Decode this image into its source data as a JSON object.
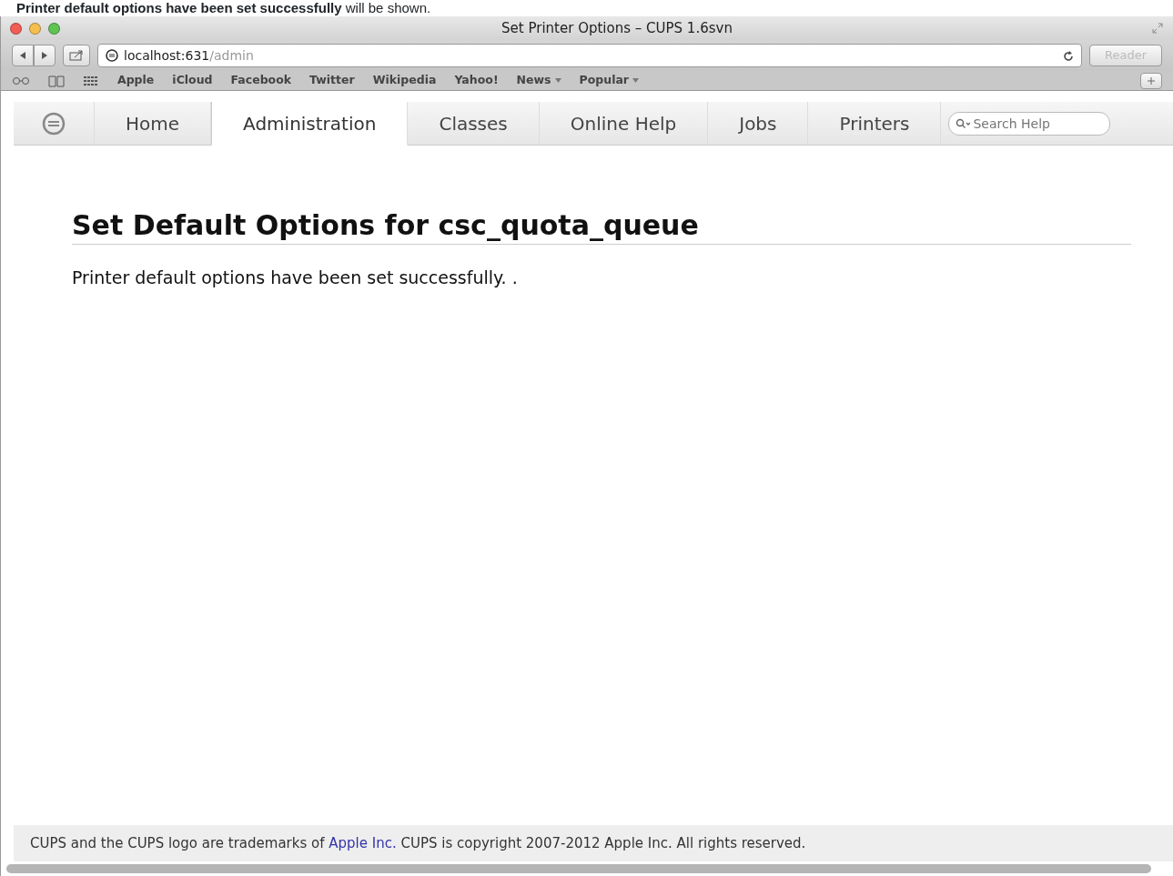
{
  "caption": {
    "bold": "Printer default options have been set successfully",
    "rest": " will be shown."
  },
  "window": {
    "title": "Set Printer Options – CUPS 1.6svn"
  },
  "address": {
    "host": "localhost:631",
    "path": "/admin"
  },
  "reader_button": "Reader",
  "bookmarks": [
    {
      "label": "Apple",
      "menu": false
    },
    {
      "label": "iCloud",
      "menu": false
    },
    {
      "label": "Facebook",
      "menu": false
    },
    {
      "label": "Twitter",
      "menu": false
    },
    {
      "label": "Wikipedia",
      "menu": false
    },
    {
      "label": "Yahoo!",
      "menu": false
    },
    {
      "label": "News",
      "menu": true
    },
    {
      "label": "Popular",
      "menu": true
    }
  ],
  "nav": [
    {
      "label": "Home",
      "selected": false
    },
    {
      "label": "Administration",
      "selected": true
    },
    {
      "label": "Classes",
      "selected": false
    },
    {
      "label": "Online Help",
      "selected": false
    },
    {
      "label": "Jobs",
      "selected": false
    },
    {
      "label": "Printers",
      "selected": false
    }
  ],
  "search": {
    "placeholder": "Search Help"
  },
  "heading": "Set Default Options for csc_quota_queue",
  "message": "Printer default options have been set successfully.   .",
  "footer": {
    "before": "CUPS and the CUPS logo are trademarks of ",
    "link": "Apple Inc.",
    "after": " CUPS is copyright 2007-2012 Apple Inc. All rights reserved."
  }
}
